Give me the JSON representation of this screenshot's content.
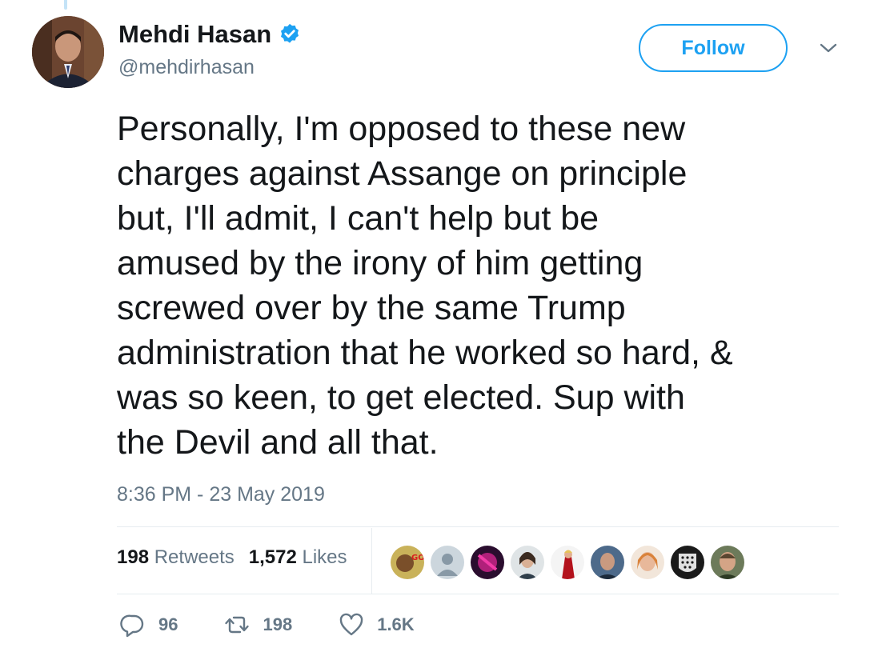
{
  "user": {
    "display_name": "Mehdi Hasan",
    "handle": "@mehdirhasan",
    "verified": true
  },
  "header": {
    "follow_label": "Follow"
  },
  "tweet": {
    "text": "Personally, I'm opposed to these new\ncharges against Assange on principle\nbut, I'll admit, I can't help but be\namused by the irony of him getting\nscrewed over by the same Trump\nadministration that he worked so hard, &\nwas so keen, to get elected. Sup with\nthe Devil and all that.",
    "timestamp": "8:36 PM - 23 May 2019"
  },
  "stats": {
    "retweets_count": "198",
    "retweets_label": "Retweets",
    "likes_count": "1,572",
    "likes_label": "Likes"
  },
  "likers": [
    "liker-avatar",
    "liker-avatar",
    "liker-avatar",
    "liker-avatar",
    "liker-avatar",
    "liker-avatar",
    "liker-avatar",
    "liker-avatar",
    "liker-avatar"
  ],
  "actions": {
    "replies": "96",
    "retweets": "198",
    "likes": "1.6K"
  },
  "colors": {
    "accent": "#1da1f2",
    "secondary_text": "#657786",
    "divider": "#e6ecf0"
  }
}
